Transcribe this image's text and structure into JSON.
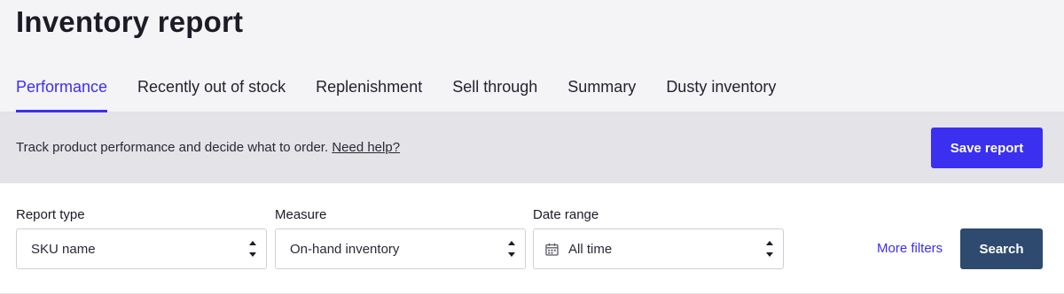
{
  "header": {
    "title": "Inventory report",
    "tabs": [
      {
        "label": "Performance",
        "active": true
      },
      {
        "label": "Recently out of stock",
        "active": false
      },
      {
        "label": "Replenishment",
        "active": false
      },
      {
        "label": "Sell through",
        "active": false
      },
      {
        "label": "Summary",
        "active": false
      },
      {
        "label": "Dusty inventory",
        "active": false
      }
    ]
  },
  "banner": {
    "description": "Track product performance and decide what to order.",
    "help_link": "Need help?",
    "save_label": "Save report"
  },
  "filters": {
    "report_type": {
      "label": "Report type",
      "value": "SKU name"
    },
    "measure": {
      "label": "Measure",
      "value": "On-hand inventory"
    },
    "date_range": {
      "label": "Date range",
      "value": "All time"
    },
    "more_filters_label": "More filters",
    "search_label": "Search"
  },
  "colors": {
    "accent": "#3b2ff0",
    "search_button": "#2e4a6e",
    "header_bg": "#f4f3f6",
    "banner_bg": "#e4e3e8"
  },
  "icons": {
    "select_arrows": "sort-arrows-icon",
    "calendar": "calendar-icon"
  }
}
